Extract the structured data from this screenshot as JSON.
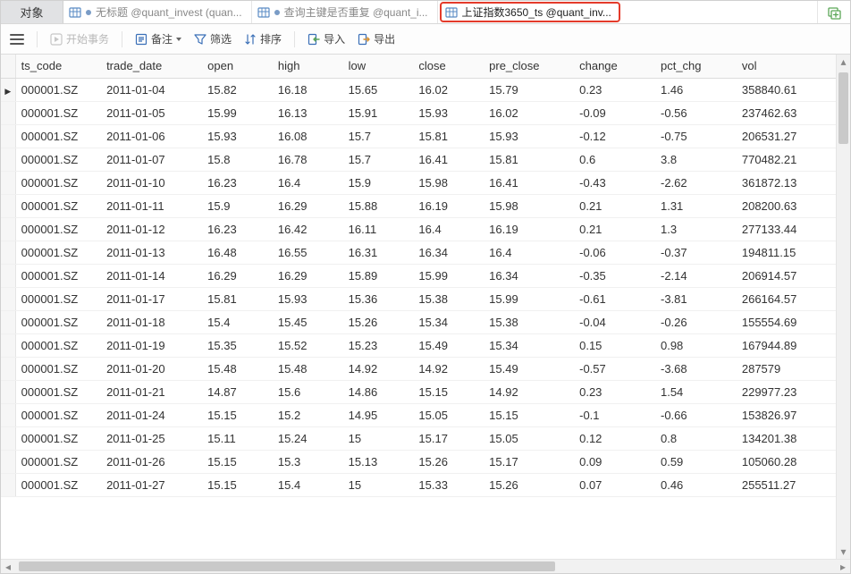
{
  "objects_tab_label": "对象",
  "tabs": [
    {
      "label": "无标题 @quant_invest (quan...",
      "dirty": true,
      "active": false
    },
    {
      "label": "查询主键是否重复 @quant_i...",
      "dirty": true,
      "active": false
    },
    {
      "label": "上证指数3650_ts @quant_inv...",
      "dirty": false,
      "active": true
    }
  ],
  "toolbar": {
    "start_tx": "开始事务",
    "memo": "备注",
    "filter": "筛选",
    "sort": "排序",
    "import": "导入",
    "export": "导出"
  },
  "columns": [
    "ts_code",
    "trade_date",
    "open",
    "high",
    "low",
    "close",
    "pre_close",
    "change",
    "pct_chg",
    "vol"
  ],
  "rows": [
    [
      "000001.SZ",
      "2011-01-04",
      "15.82",
      "16.18",
      "15.65",
      "16.02",
      "15.79",
      "0.23",
      "1.46",
      "358840.61"
    ],
    [
      "000001.SZ",
      "2011-01-05",
      "15.99",
      "16.13",
      "15.91",
      "15.93",
      "16.02",
      "-0.09",
      "-0.56",
      "237462.63"
    ],
    [
      "000001.SZ",
      "2011-01-06",
      "15.93",
      "16.08",
      "15.7",
      "15.81",
      "15.93",
      "-0.12",
      "-0.75",
      "206531.27"
    ],
    [
      "000001.SZ",
      "2011-01-07",
      "15.8",
      "16.78",
      "15.7",
      "16.41",
      "15.81",
      "0.6",
      "3.8",
      "770482.21"
    ],
    [
      "000001.SZ",
      "2011-01-10",
      "16.23",
      "16.4",
      "15.9",
      "15.98",
      "16.41",
      "-0.43",
      "-2.62",
      "361872.13"
    ],
    [
      "000001.SZ",
      "2011-01-11",
      "15.9",
      "16.29",
      "15.88",
      "16.19",
      "15.98",
      "0.21",
      "1.31",
      "208200.63"
    ],
    [
      "000001.SZ",
      "2011-01-12",
      "16.23",
      "16.42",
      "16.11",
      "16.4",
      "16.19",
      "0.21",
      "1.3",
      "277133.44"
    ],
    [
      "000001.SZ",
      "2011-01-13",
      "16.48",
      "16.55",
      "16.31",
      "16.34",
      "16.4",
      "-0.06",
      "-0.37",
      "194811.15"
    ],
    [
      "000001.SZ",
      "2011-01-14",
      "16.29",
      "16.29",
      "15.89",
      "15.99",
      "16.34",
      "-0.35",
      "-2.14",
      "206914.57"
    ],
    [
      "000001.SZ",
      "2011-01-17",
      "15.81",
      "15.93",
      "15.36",
      "15.38",
      "15.99",
      "-0.61",
      "-3.81",
      "266164.57"
    ],
    [
      "000001.SZ",
      "2011-01-18",
      "15.4",
      "15.45",
      "15.26",
      "15.34",
      "15.38",
      "-0.04",
      "-0.26",
      "155554.69"
    ],
    [
      "000001.SZ",
      "2011-01-19",
      "15.35",
      "15.52",
      "15.23",
      "15.49",
      "15.34",
      "0.15",
      "0.98",
      "167944.89"
    ],
    [
      "000001.SZ",
      "2011-01-20",
      "15.48",
      "15.48",
      "14.92",
      "14.92",
      "15.49",
      "-0.57",
      "-3.68",
      "287579"
    ],
    [
      "000001.SZ",
      "2011-01-21",
      "14.87",
      "15.6",
      "14.86",
      "15.15",
      "14.92",
      "0.23",
      "1.54",
      "229977.23"
    ],
    [
      "000001.SZ",
      "2011-01-24",
      "15.15",
      "15.2",
      "14.95",
      "15.05",
      "15.15",
      "-0.1",
      "-0.66",
      "153826.97"
    ],
    [
      "000001.SZ",
      "2011-01-25",
      "15.11",
      "15.24",
      "15",
      "15.17",
      "15.05",
      "0.12",
      "0.8",
      "134201.38"
    ],
    [
      "000001.SZ",
      "2011-01-26",
      "15.15",
      "15.3",
      "15.13",
      "15.26",
      "15.17",
      "0.09",
      "0.59",
      "105060.28"
    ],
    [
      "000001.SZ",
      "2011-01-27",
      "15.15",
      "15.4",
      "15",
      "15.33",
      "15.26",
      "0.07",
      "0.46",
      "255511.27"
    ]
  ],
  "current_row_index": 0,
  "colors": {
    "tab_highlight_border": "#e43b2b",
    "dirty_dot": "#7a9cc6"
  }
}
